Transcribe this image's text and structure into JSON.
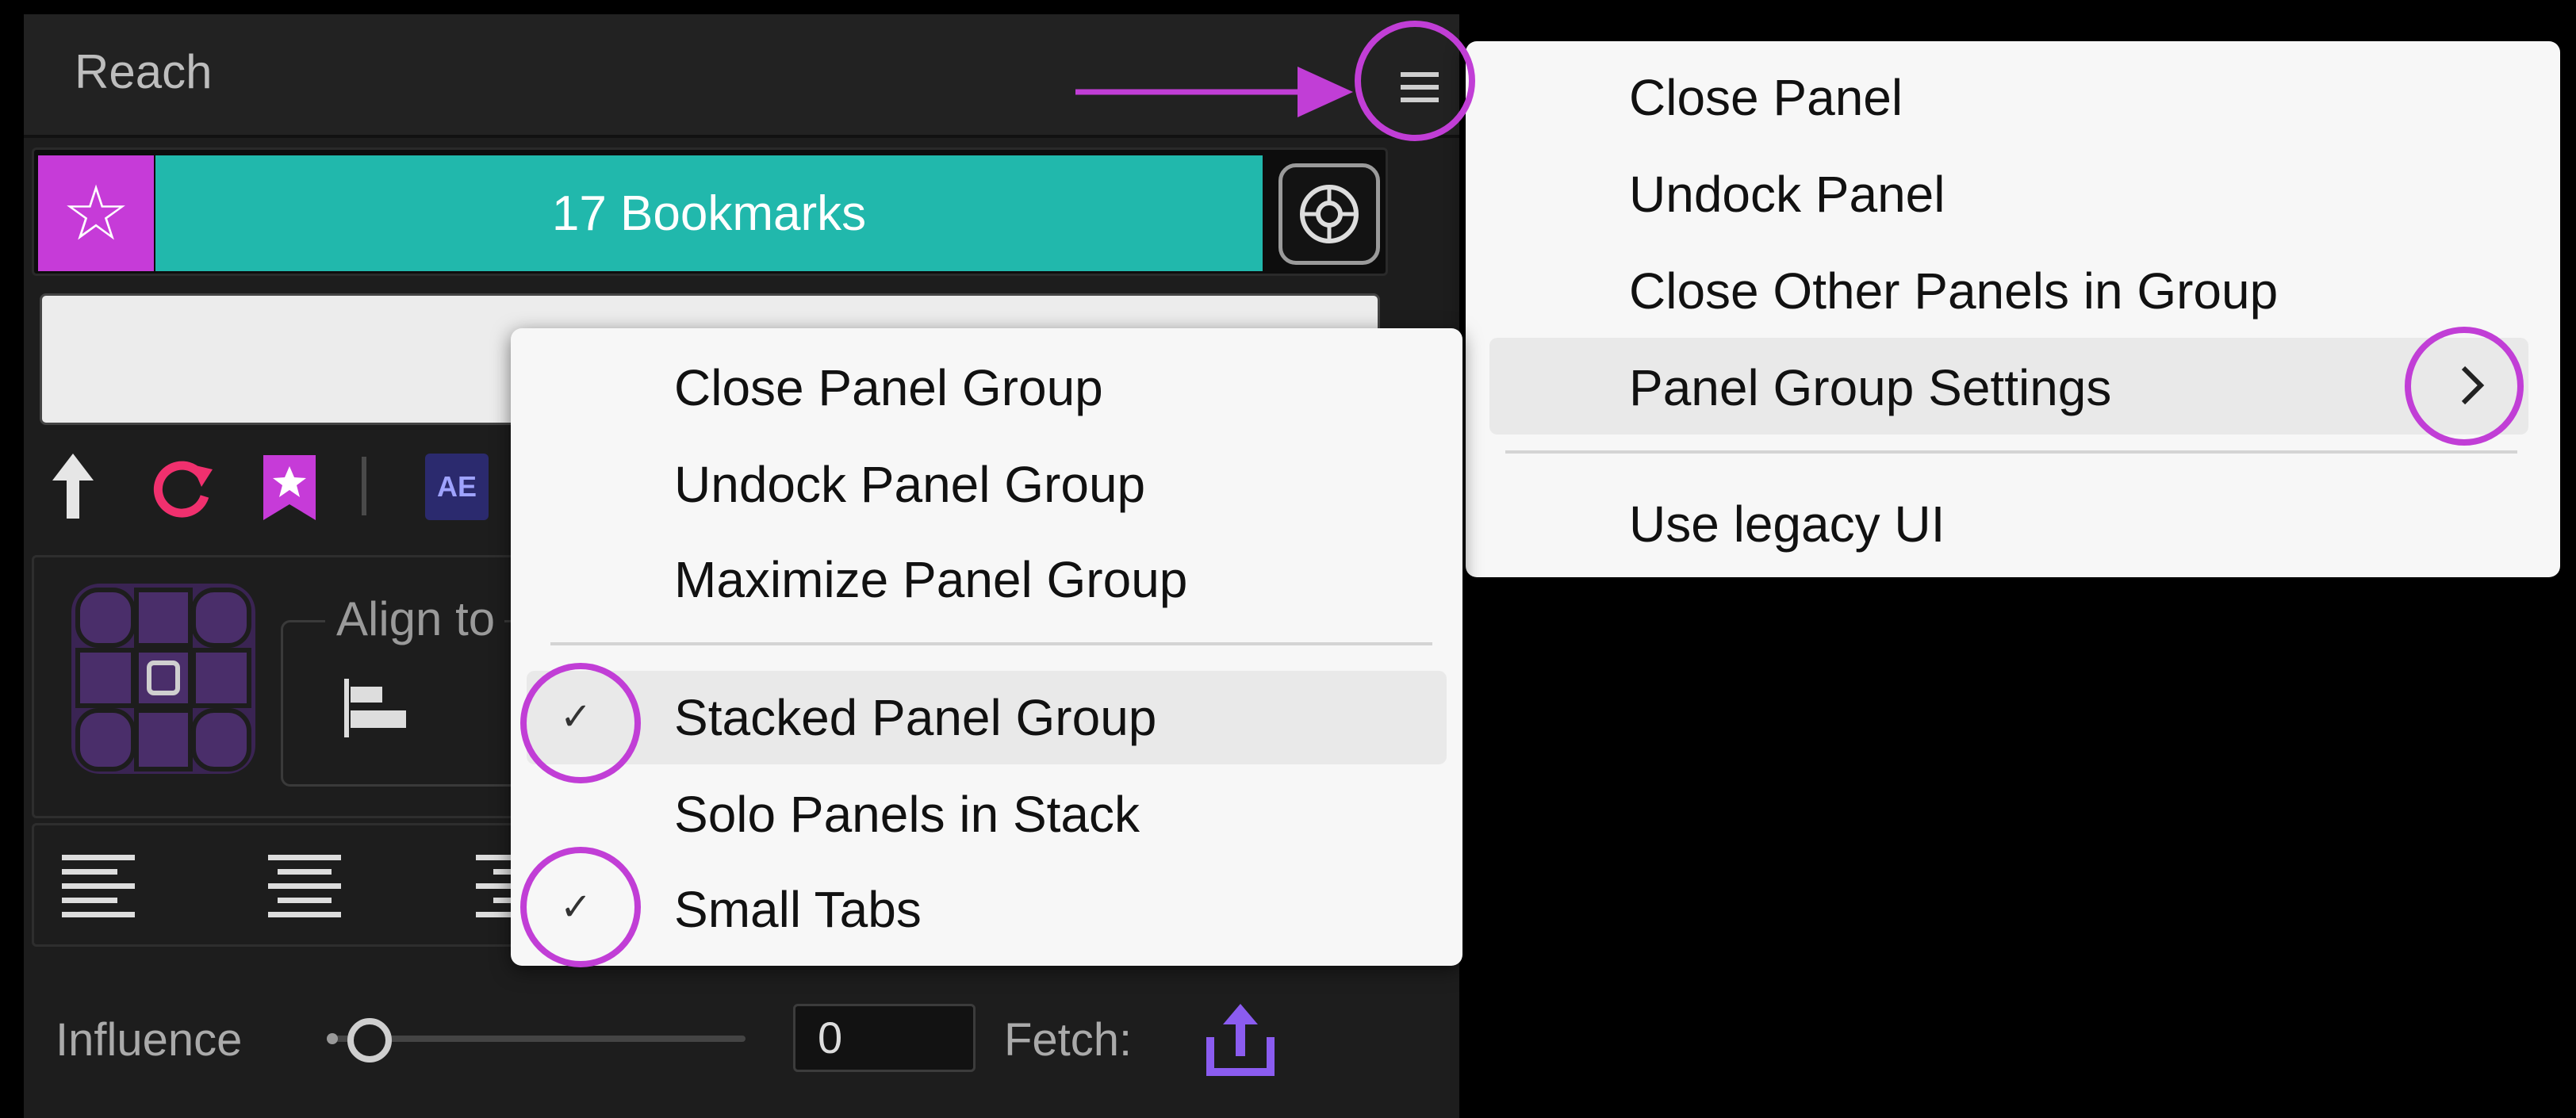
{
  "panel": {
    "title": "Reach",
    "bookmarks_label": "17 Bookmarks",
    "align_to_label": "Align to",
    "influence_label": "Influence",
    "influence_value": "0",
    "fetch_label": "Fetch:"
  },
  "main_menu": {
    "items": [
      "Close Panel",
      "Undock Panel",
      "Close Other Panels in Group",
      "Panel Group Settings",
      "Use legacy UI"
    ]
  },
  "sub_menu": {
    "items": [
      "Close Panel Group",
      "Undock Panel Group",
      "Maximize Panel Group",
      "Stacked Panel Group",
      "Solo Panels in Stack",
      "Small Tabs"
    ],
    "checked": [
      "Stacked Panel Group",
      "Small Tabs"
    ]
  },
  "colors": {
    "accent_magenta": "#c63bd8",
    "teal": "#21b8ac",
    "annotation": "#c13ed6"
  },
  "icons": [
    "star-icon",
    "settings-gear-icon",
    "up-arrow-icon",
    "refresh-icon",
    "bookmark-icon",
    "ae-icon",
    "align-left-icon",
    "text-align-left-icon",
    "text-align-center-icon",
    "text-align-right-icon",
    "fetch-upload-icon",
    "chevron-right-icon",
    "checkmark-icon",
    "hamburger-menu-icon"
  ]
}
